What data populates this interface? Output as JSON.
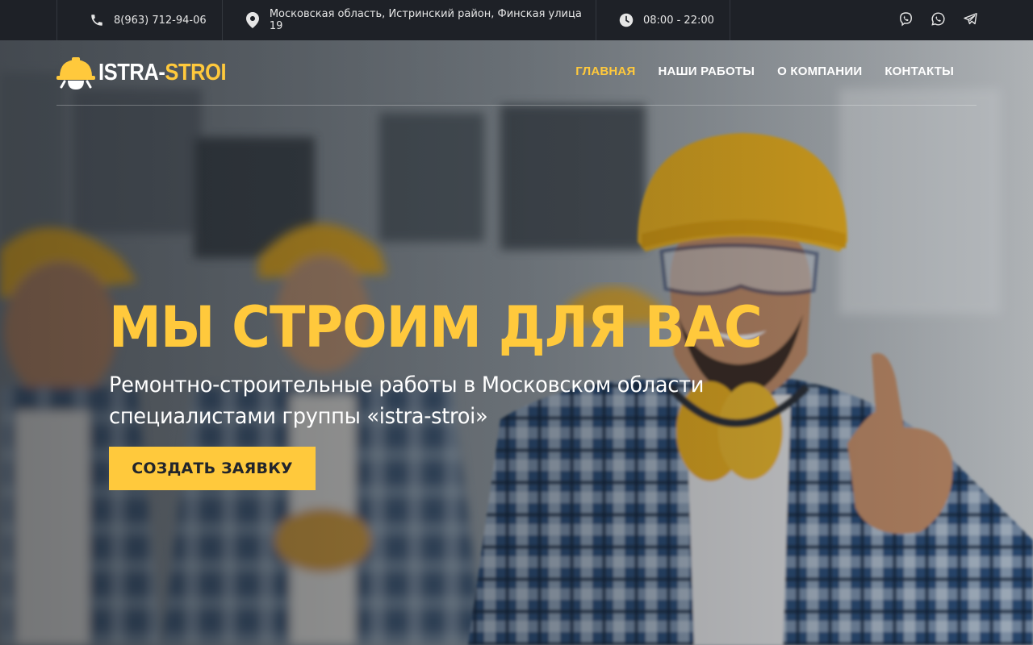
{
  "topbar": {
    "phone": "8(963) 712-94-06",
    "address": "Московская область, Истринский район, Финская улица 19",
    "hours": "08:00 - 22:00",
    "social": [
      "viber-icon",
      "whatsapp-icon",
      "telegram-icon"
    ]
  },
  "logo": {
    "part1": "ISTRA-",
    "part2": "STROI"
  },
  "nav": {
    "items": [
      {
        "label": "ГЛАВНАЯ",
        "active": true
      },
      {
        "label": "НАШИ РАБОТЫ",
        "active": false
      },
      {
        "label": "О КОМПАНИИ",
        "active": false
      },
      {
        "label": "КОНТАКТЫ",
        "active": false
      }
    ]
  },
  "hero": {
    "title": "МЫ СТРОИМ ДЛЯ ВАС",
    "subtitle": "Ремонтно-строительные работы в Московском области специалистами группы «istra-stroi»",
    "cta_label": "СОЗДАТЬ ЗАЯВКУ"
  },
  "colors": {
    "accent": "#ffc93c",
    "topbar_bg": "#1e2127",
    "text_dark": "#22252b"
  }
}
